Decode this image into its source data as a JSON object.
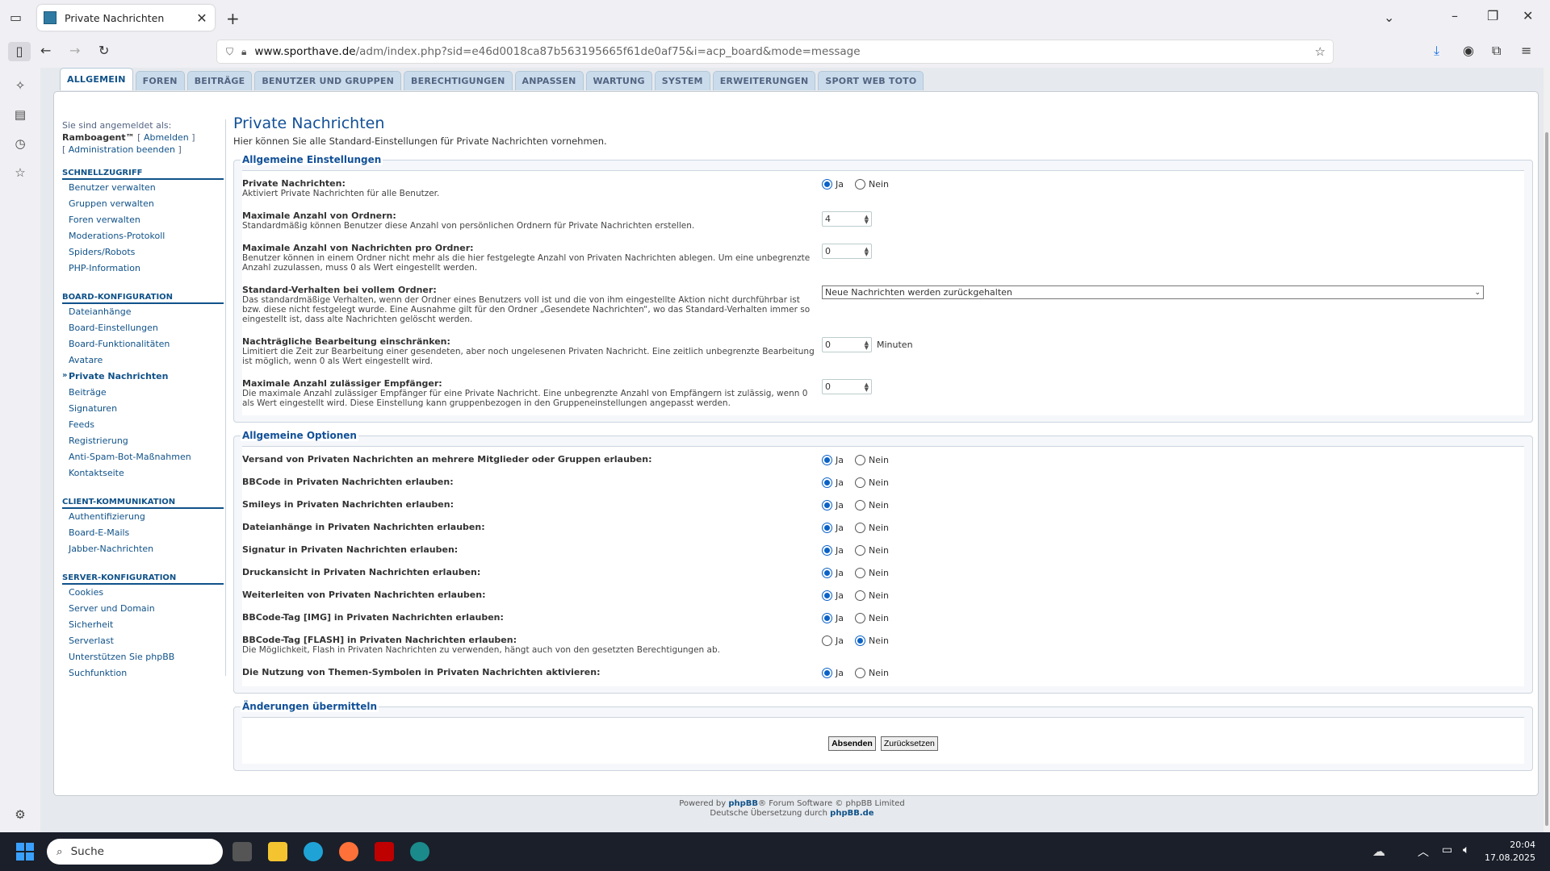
{
  "browser": {
    "tab_title": "Private Nachrichten",
    "url_host": "www.sporthave.de",
    "url_path": "/adm/index.php?sid=e46d0018ca87b563195665f61de0af75&i=acp_board&mode=message"
  },
  "acp_tabs": [
    "ALLGEMEIN",
    "FOREN",
    "BEITRÄGE",
    "BENUTZER UND GRUPPEN",
    "BERECHTIGUNGEN",
    "ANPASSEN",
    "WARTUNG",
    "SYSTEM",
    "ERWEITERUNGEN",
    "SPORT WEB TOTO"
  ],
  "login": {
    "prefix": "Sie sind angemeldet als:",
    "user": "Ramboagent™",
    "logout": "Abmelden",
    "admin_end": "Administration beenden"
  },
  "menu": {
    "quick_header": "SCHNELLZUGRIFF",
    "quick": [
      "Benutzer verwalten",
      "Gruppen verwalten",
      "Foren verwalten",
      "Moderations-Protokoll",
      "Spiders/Robots",
      "PHP-Information"
    ],
    "board_header": "BOARD-KONFIGURATION",
    "board": [
      "Dateianhänge",
      "Board-Einstellungen",
      "Board-Funktionalitäten",
      "Avatare",
      "Private Nachrichten",
      "Beiträge",
      "Signaturen",
      "Feeds",
      "Registrierung",
      "Anti-Spam-Bot-Maßnahmen",
      "Kontaktseite"
    ],
    "client_header": "CLIENT-KOMMUNIKATION",
    "client": [
      "Authentifizierung",
      "Board-E-Mails",
      "Jabber-Nachrichten"
    ],
    "server_header": "SERVER-KONFIGURATION",
    "server": [
      "Cookies",
      "Server und Domain",
      "Sicherheit",
      "Serverlast",
      "Unterstützen Sie phpBB",
      "Suchfunktion"
    ]
  },
  "page": {
    "title": "Private Nachrichten",
    "desc": "Hier können Sie alle Standard-Einstellungen für Private Nachrichten vornehmen."
  },
  "general": {
    "legend": "Allgemeine Einstellungen",
    "pm_enable_title": "Private Nachrichten:",
    "pm_enable_desc": "Aktiviert Private Nachrichten für alle Benutzer.",
    "max_boxes_title": "Maximale Anzahl von Ordnern:",
    "max_boxes_desc": "Standardmäßig können Benutzer diese Anzahl von persönlichen Ordnern für Private Nachrichten erstellen.",
    "max_boxes_value": "4",
    "max_msgs_title": "Maximale Anzahl von Nachrichten pro Ordner:",
    "max_msgs_desc": "Benutzer können in einem Ordner nicht mehr als die hier festgelegte Anzahl von Privaten Nachrichten ablegen. Um eine unbegrenzte Anzahl zuzulassen, muss 0 als Wert eingestellt werden.",
    "max_msgs_value": "0",
    "full_folder_title": "Standard-Verhalten bei vollem Ordner:",
    "full_folder_desc": "Das standardmäßige Verhalten, wenn der Ordner eines Benutzers voll ist und die von ihm eingestellte Aktion nicht durchführbar ist bzw. diese nicht festgelegt wurde. Eine Ausnahme gilt für den Ordner „Gesendete Nachrichten“, wo das Standard-Verhalten immer so eingestellt ist, dass alte Nachrichten gelöscht werden.",
    "full_folder_value": "Neue Nachrichten werden zurückgehalten",
    "edit_time_title": "Nachträgliche Bearbeitung einschränken:",
    "edit_time_desc": "Limitiert die Zeit zur Bearbeitung einer gesendeten, aber noch ungelesenen Privaten Nachricht. Eine zeitlich unbegrenzte Bearbeitung ist möglich, wenn 0 als Wert eingestellt wird.",
    "edit_time_value": "0",
    "edit_time_unit": "Minuten",
    "max_recip_title": "Maximale Anzahl zulässiger Empfänger:",
    "max_recip_desc": "Die maximale Anzahl zulässiger Empfänger für eine Private Nachricht. Eine unbegrenzte Anzahl von Empfängern ist zulässig, wenn 0 als Wert eingestellt wird. Diese Einstellung kann gruppenbezogen in den Gruppeneinstellungen angepasst werden.",
    "max_recip_value": "0"
  },
  "yes": "Ja",
  "no": "Nein",
  "options": {
    "legend": "Allgemeine Optionen",
    "items": [
      {
        "label": "Versand von Privaten Nachrichten an mehrere Mitglieder oder Gruppen erlauben:",
        "desc": "",
        "value": "yes"
      },
      {
        "label": "BBCode in Privaten Nachrichten erlauben:",
        "desc": "",
        "value": "yes"
      },
      {
        "label": "Smileys in Privaten Nachrichten erlauben:",
        "desc": "",
        "value": "yes"
      },
      {
        "label": "Dateianhänge in Privaten Nachrichten erlauben:",
        "desc": "",
        "value": "yes"
      },
      {
        "label": "Signatur in Privaten Nachrichten erlauben:",
        "desc": "",
        "value": "yes"
      },
      {
        "label": "Druckansicht in Privaten Nachrichten erlauben:",
        "desc": "",
        "value": "yes"
      },
      {
        "label": "Weiterleiten von Privaten Nachrichten erlauben:",
        "desc": "",
        "value": "yes"
      },
      {
        "label": "BBCode-Tag [IMG] in Privaten Nachrichten erlauben:",
        "desc": "",
        "value": "yes"
      },
      {
        "label": "BBCode-Tag [FLASH] in Privaten Nachrichten erlauben:",
        "desc": "Die Möglichkeit, Flash in Privaten Nachrichten zu verwenden, hängt auch von den gesetzten Berechtigungen ab.",
        "value": "no"
      },
      {
        "label": "Die Nutzung von Themen-Symbolen in Privaten Nachrichten aktivieren:",
        "desc": "",
        "value": "yes"
      }
    ]
  },
  "submit": {
    "legend": "Änderungen übermitteln",
    "send": "Absenden",
    "reset": "Zurücksetzen"
  },
  "footer": {
    "line1_pre": "Powered by",
    "line1_brand": "phpBB",
    "line1_post": "® Forum Software © phpBB Limited",
    "line2_pre": "Deutsche Übersetzung durch",
    "line2_link": "phpBB.de"
  },
  "taskbar": {
    "search": "Suche",
    "time": "20:04",
    "date": "17.08.2025"
  }
}
